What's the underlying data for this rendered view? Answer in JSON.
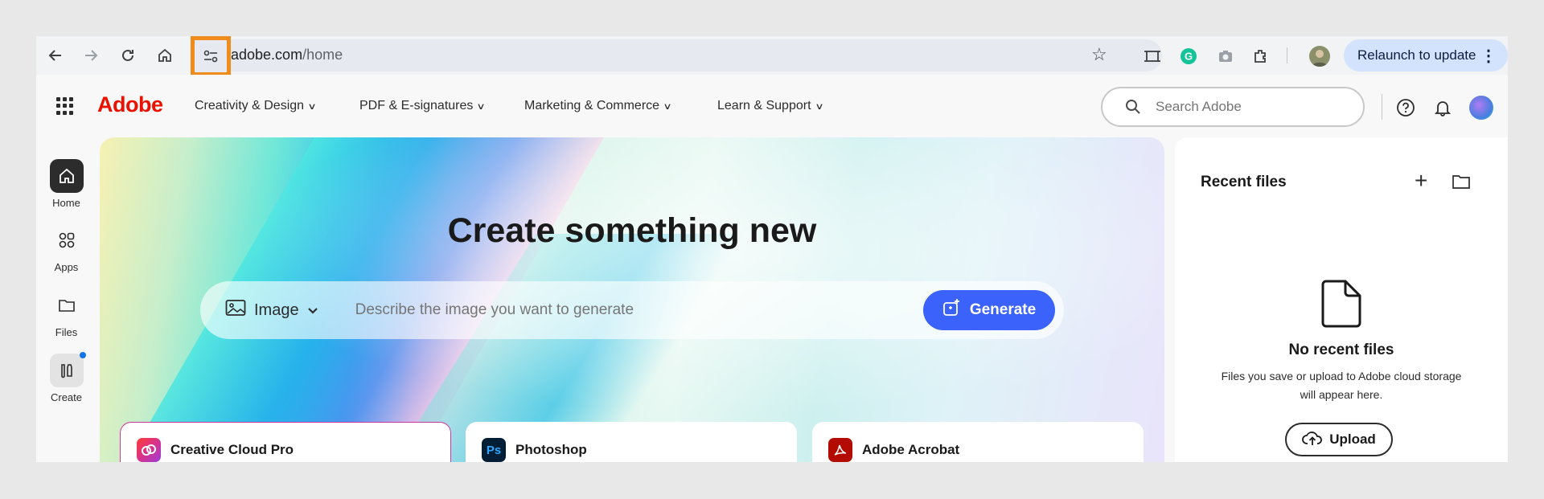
{
  "browser": {
    "url_host": "adobe.com",
    "url_path": "/home",
    "relaunch_label": "Relaunch to update"
  },
  "header": {
    "logo": "Adobe",
    "nav": [
      {
        "label": "Creativity & Design"
      },
      {
        "label": "PDF & E-signatures"
      },
      {
        "label": "Marketing & Commerce"
      },
      {
        "label": "Learn & Support"
      }
    ],
    "search_placeholder": "Search Adobe"
  },
  "rail": [
    {
      "label": "Home",
      "icon": "home-icon"
    },
    {
      "label": "Apps",
      "icon": "apps-icon"
    },
    {
      "label": "Files",
      "icon": "folder-icon"
    },
    {
      "label": "Create",
      "icon": "create-icon"
    }
  ],
  "hero": {
    "title": "Create something new",
    "media_type": "Image",
    "prompt_placeholder": "Describe the image you want to generate",
    "generate_label": "Generate"
  },
  "apps": [
    {
      "name": "Creative Cloud Pro",
      "color": "#e0316f"
    },
    {
      "name": "Photoshop",
      "color": "#001e36",
      "abbr": "Ps"
    },
    {
      "name": "Adobe Acrobat",
      "color": "#b30b00"
    }
  ],
  "recent": {
    "title": "Recent files",
    "empty_title": "No recent files",
    "empty_text": "Files you save or upload to Adobe cloud storage will appear here.",
    "upload_label": "Upload"
  },
  "colors": {
    "brand": "#eb1000",
    "accent": "#3b63fb",
    "highlight": "#f08c1c"
  }
}
